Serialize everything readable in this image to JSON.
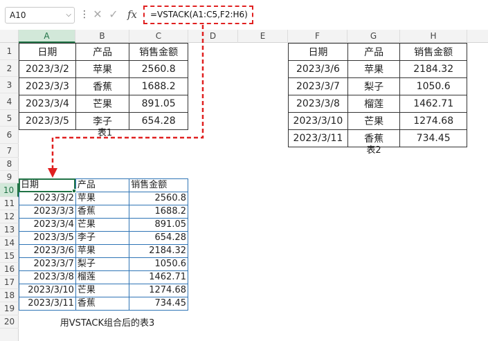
{
  "formula_bar": {
    "name_box": "A10",
    "formula": "=VSTACK(A1:C5,F2:H6)",
    "fx_symbol": "fx",
    "cancel_symbol": "✕",
    "enter_symbol": "✓",
    "more_symbol": "⋮"
  },
  "columns": [
    "A",
    "B",
    "C",
    "D",
    "E",
    "F",
    "G",
    "H"
  ],
  "rows": [
    "1",
    "2",
    "3",
    "4",
    "5",
    "6",
    "7",
    "8",
    "9",
    "10",
    "11",
    "12",
    "13",
    "14",
    "15",
    "16",
    "17",
    "18",
    "19",
    "20"
  ],
  "table1": {
    "header": [
      "日期",
      "产品",
      "销售金额"
    ],
    "rows": [
      [
        "2023/3/2",
        "苹果",
        "2560.8"
      ],
      [
        "2023/3/3",
        "香蕉",
        "1688.2"
      ],
      [
        "2023/3/4",
        "芒果",
        "891.05"
      ],
      [
        "2023/3/5",
        "李子",
        "654.28"
      ]
    ],
    "caption": "表1"
  },
  "table2": {
    "header": [
      "日期",
      "产品",
      "销售金额"
    ],
    "rows": [
      [
        "2023/3/6",
        "苹果",
        "2184.32"
      ],
      [
        "2023/3/7",
        "梨子",
        "1050.6"
      ],
      [
        "2023/3/8",
        "榴莲",
        "1462.71"
      ],
      [
        "2023/3/10",
        "芒果",
        "1274.68"
      ],
      [
        "2023/3/11",
        "香蕉",
        "734.45"
      ]
    ],
    "caption": "表2"
  },
  "table3": {
    "header": [
      "日期",
      "产品",
      "销售金额"
    ],
    "rows": [
      [
        "2023/3/2",
        "苹果",
        "2560.8"
      ],
      [
        "2023/3/3",
        "香蕉",
        "1688.2"
      ],
      [
        "2023/3/4",
        "芒果",
        "891.05"
      ],
      [
        "2023/3/5",
        "李子",
        "654.28"
      ],
      [
        "2023/3/6",
        "苹果",
        "2184.32"
      ],
      [
        "2023/3/7",
        "梨子",
        "1050.6"
      ],
      [
        "2023/3/8",
        "榴莲",
        "1462.71"
      ],
      [
        "2023/3/10",
        "芒果",
        "1274.68"
      ],
      [
        "2023/3/11",
        "香蕉",
        "734.45"
      ]
    ],
    "caption": "用VSTACK组合后的表3"
  },
  "colors": {
    "accent": "#217346",
    "annotation": "#e02020",
    "table3_border": "#2e74b5"
  }
}
